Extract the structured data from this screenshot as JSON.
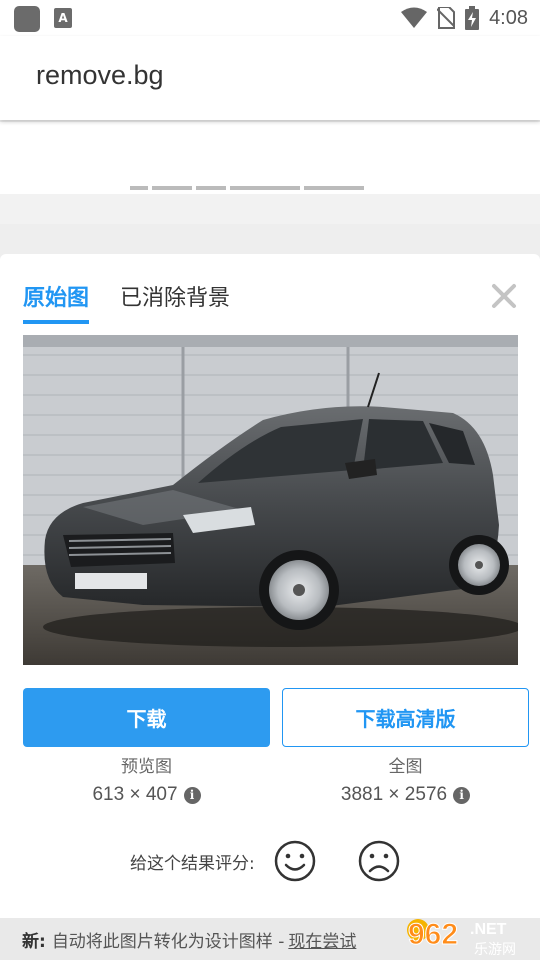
{
  "status_bar": {
    "time": "4:08",
    "notif_letter": "A"
  },
  "app_bar": {
    "title": "remove.bg"
  },
  "modal": {
    "tabs": [
      {
        "label": "原始图"
      },
      {
        "label": "已消除背景"
      }
    ],
    "download": {
      "primary_label": "下载",
      "hd_label": "下载高清版",
      "preview_label": "预览图",
      "preview_size": "613 × 407",
      "full_label": "全图",
      "full_size": "3881 × 2576"
    },
    "rating": {
      "label": "给这个结果评分:"
    }
  },
  "footer": {
    "new_label": "新:",
    "text": "自动将此图片转化为设计图样 - ",
    "try_label": "现在尝试"
  },
  "watermark": {
    "text": "962",
    "suffix": ".NET",
    "sub": "乐游网"
  },
  "colors": {
    "accent": "#2196f3",
    "button": "#2d9bf0"
  }
}
